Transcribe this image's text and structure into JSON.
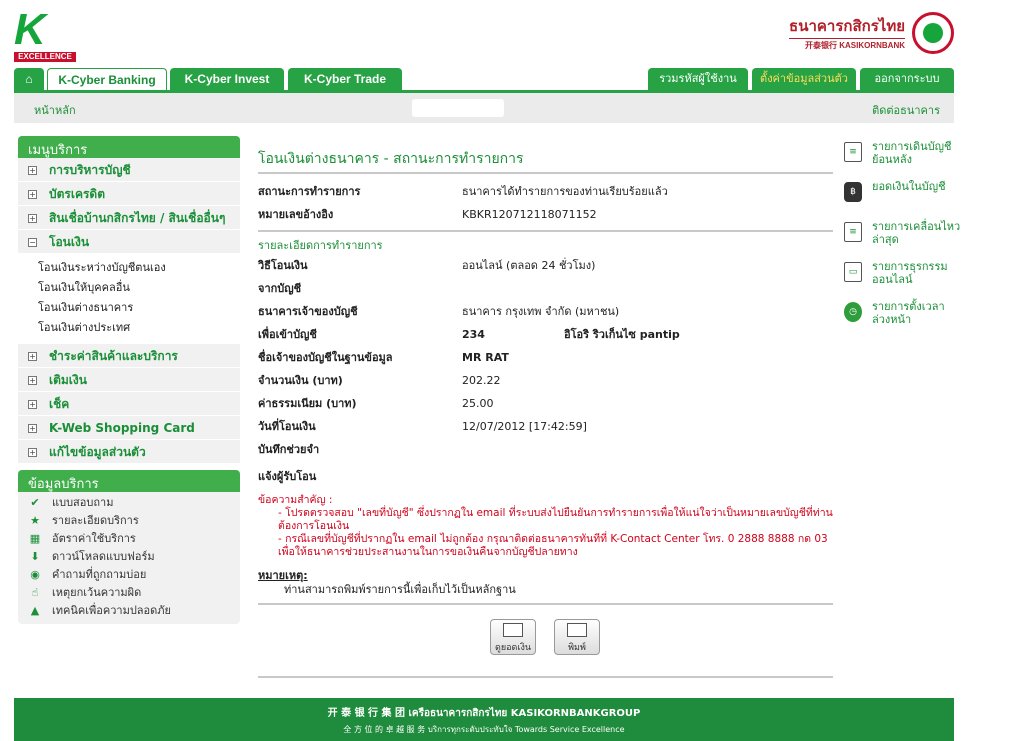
{
  "header": {
    "logo_letter": "K",
    "logo_sub": "EXCELLENCE",
    "bank_name_th": "ธนาคารกสิกรไทย",
    "bank_name_en": "开泰银行 KASIKORNBANK"
  },
  "nav": {
    "home_icon": "home-icon",
    "tabs": [
      "K-Cyber Banking",
      "K-Cyber Invest",
      "K-Cyber Trade"
    ],
    "right": [
      "รวมรหัสผู้ใช้งาน",
      "ตั้งค่าข้อมูลส่วนตัว",
      "ออกจากระบบ"
    ]
  },
  "subbar": {
    "home": "หน้าหลัก",
    "contact": "ติดต่อธนาคาร"
  },
  "sidebar": {
    "menu_title": "เมนูบริการ",
    "items": [
      {
        "label": "การบริหารบัญชี",
        "sign": "+"
      },
      {
        "label": "บัตรเครดิต",
        "sign": "+"
      },
      {
        "label": "สินเชื่อบ้านกสิกรไทย / สินเชื่ออื่นๆ",
        "sign": "+"
      },
      {
        "label": "โอนเงิน",
        "sign": "−"
      }
    ],
    "transfer_sub": [
      "โอนเงินระหว่างบัญชีตนเอง",
      "โอนเงินให้บุคคลอื่น",
      "โอนเงินต่างธนาคาร",
      "โอนเงินต่างประเทศ"
    ],
    "items2": [
      {
        "label": "ชำระค่าสินค้าและบริการ",
        "sign": "+"
      },
      {
        "label": "เติมเงิน",
        "sign": "+"
      },
      {
        "label": "เช็ค",
        "sign": "+"
      },
      {
        "label": "K-Web Shopping Card",
        "sign": "+"
      },
      {
        "label": "แก้ไขข้อมูลส่วนตัว",
        "sign": "+"
      }
    ],
    "info_title": "ข้อมูลบริการ",
    "info": [
      {
        "icon": "check-icon",
        "glyph": "✔",
        "label": "แบบสอบถาม"
      },
      {
        "icon": "star-icon",
        "glyph": "★",
        "label": "รายละเอียดบริการ"
      },
      {
        "icon": "calculator-icon",
        "glyph": "▦",
        "label": "อัตราค่าใช้บริการ"
      },
      {
        "icon": "download-icon",
        "glyph": "⬇",
        "label": "ดาวน์โหลดแบบฟอร์ม"
      },
      {
        "icon": "question-icon",
        "glyph": "◉",
        "label": "คำถามที่ถูกถามบ่อย"
      },
      {
        "icon": "hand-icon",
        "glyph": "☝",
        "label": "เหตุยกเว้นความผิด"
      },
      {
        "icon": "lock-icon",
        "glyph": "▲",
        "label": "เทคนิคเพื่อความปลอดภัย"
      }
    ]
  },
  "main": {
    "title": "โอนเงินต่างธนาคาร - สถานะการทำรายการ",
    "status_label": "สถานะการทำรายการ",
    "status_value": "ธนาคารได้ทำรายการของท่านเรียบร้อยแล้ว",
    "ref_label": "หมายเลขอ้างอิง",
    "ref_value": "KBKR120712118071152",
    "details_title": "รายละเอียดการทำรายการ",
    "method_label": "วิธีโอนเงิน",
    "method_value": "ออนไลน์ (ตลอด 24 ชั่วโมง)",
    "from_label": "จากบัญชี",
    "bank_label": "ธนาคารเจ้าของบัญชี",
    "bank_value": "ธนาคาร กรุงเทพ จำกัด (มหาชน)",
    "to_label": "เพื่อเข้าบัญชี",
    "to_value": "234",
    "to_name": "อิโอริ ริวเก็นไซ pantip",
    "owner_label": "ชื่อเจ้าของบัญชีในฐานข้อมูล",
    "owner_value": "MR RAT",
    "amount_label": "จำนวนเงิน (บาท)",
    "amount_value": "202.22",
    "fee_label": "ค่าธรรมเนียม (บาท)",
    "fee_value": "25.00",
    "date_label": "วันที่โอนเงิน",
    "date_value": "12/07/2012 [17:42:59]",
    "memo_label": "บันทึกช่วยจำ",
    "notify_label": "แจ้งผู้รับโอน",
    "notice_title": "ข้อความสำคัญ :",
    "notice_1": "- โปรดตรวจสอบ \"เลขที่บัญชี\" ซึ่งปรากฏใน email ที่ระบบส่งไปยืนยันการทำรายการเพื่อให้แน่ใจว่าเป็นหมายเลขบัญชีที่ท่านต้องการโอนเงิน",
    "notice_2": "- กรณีเลขที่บัญชีที่ปรากฏใน email ไม่ถูกต้อง กรุณาติดต่อธนาคารทันทีที่ K-Contact Center โทร. 0 2888 8888 กด 03 เพื่อให้ธนาคารช่วยประสานงานในการขอเงินคืนจากบัญชีปลายทาง",
    "remark_title": "หมายเหตุ:",
    "remark_text": "ท่านสามารถพิมพ์รายการนี้เพื่อเก็บไว้เป็นหลักฐาน",
    "btn_balance": "ดูยอดเงิน",
    "btn_print": "พิมพ์"
  },
  "right_links": [
    {
      "icon": "statement-icon",
      "glyph": "≡",
      "label": "รายการเดินบัญชีย้อนหลัง"
    },
    {
      "icon": "balance-icon",
      "glyph": "฿",
      "label": "ยอดเงินในบัญชี"
    },
    {
      "icon": "recent-icon",
      "glyph": "≡",
      "label": "รายการเคลื่อนไหวล่าสุด"
    },
    {
      "icon": "online-icon",
      "glyph": "▭",
      "label": "รายการธุรกรรมออนไลน์"
    },
    {
      "icon": "clock-icon",
      "glyph": "◷",
      "label": "รายการตั้งเวลาล่วงหน้า"
    }
  ],
  "footer": {
    "line1": "开 泰 银 行 集 团 เครือธนาคารกสิกรไทย KASIKORNBANKGROUP",
    "line2": "全 方 位 的 卓 越 服 务 บริการทุกระดับประทับใจ Towards Service Excellence"
  },
  "colors": {
    "brand_green": "#27a244",
    "brand_red": "#c8102e",
    "link_green": "#1a8f37"
  }
}
